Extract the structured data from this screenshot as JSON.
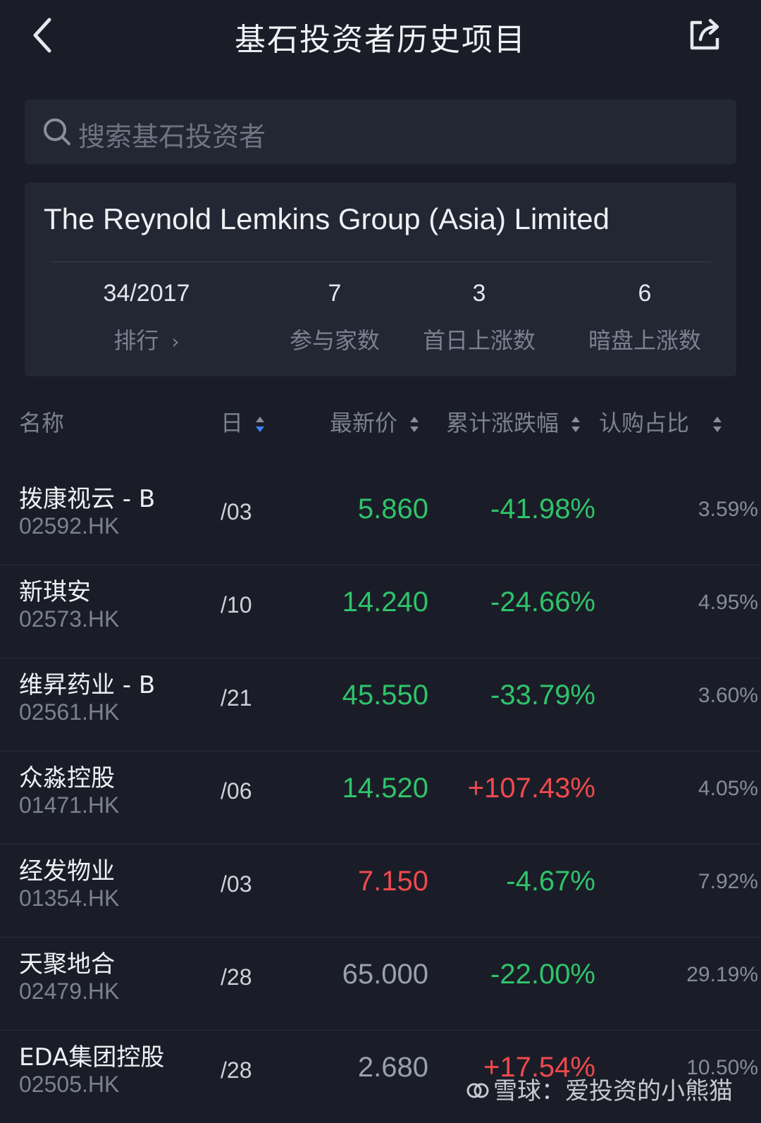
{
  "header": {
    "title": "基石投资者历史项目"
  },
  "search": {
    "placeholder": "搜索基石投资者"
  },
  "investor": {
    "name": "The Reynold Lemkins Group (Asia) Limited",
    "stats": [
      {
        "value": "34/2017",
        "label": "排行"
      },
      {
        "value": "7",
        "label": "参与家数"
      },
      {
        "value": "3",
        "label": "首日上涨数"
      },
      {
        "value": "6",
        "label": "暗盘上涨数"
      }
    ]
  },
  "table": {
    "headers": {
      "name": "名称",
      "date": "日",
      "price": "最新价",
      "change": "累计涨跌幅",
      "ratio": "认购占比"
    },
    "rows": [
      {
        "name": "拨康视云 - B",
        "code": "02592.HK",
        "date": "/03",
        "price": "5.860",
        "change": "-41.98%",
        "ratio": "3.59%",
        "price_color": "#2fc36b",
        "change_color": "#2fc36b"
      },
      {
        "name": "新琪安",
        "code": "02573.HK",
        "date": "/10",
        "price": "14.240",
        "change": "-24.66%",
        "ratio": "4.95%",
        "price_color": "#2fc36b",
        "change_color": "#2fc36b"
      },
      {
        "name": "维昇药业 - B",
        "code": "02561.HK",
        "date": "/21",
        "price": "45.550",
        "change": "-33.79%",
        "ratio": "3.60%",
        "price_color": "#2fc36b",
        "change_color": "#2fc36b"
      },
      {
        "name": "众淼控股",
        "code": "01471.HK",
        "date": "/06",
        "price": "14.520",
        "change": "+107.43%",
        "ratio": "4.05%",
        "price_color": "#2fc36b",
        "change_color": "#f0494d"
      },
      {
        "name": "经发物业",
        "code": "01354.HK",
        "date": "/03",
        "price": "7.150",
        "change": "-4.67%",
        "ratio": "7.92%",
        "price_color": "#f0494d",
        "change_color": "#2fc36b"
      },
      {
        "name": "天聚地合",
        "code": "02479.HK",
        "date": "/28",
        "price": "65.000",
        "change": "-22.00%",
        "ratio": "29.19%",
        "price_color": "#9aa0ac",
        "change_color": "#2fc36b"
      },
      {
        "name": "EDA集团控股",
        "code": "02505.HK",
        "date": "/28",
        "price": "2.680",
        "change": "+17.54%",
        "ratio": "10.50%",
        "price_color": "#9aa0ac",
        "change_color": "#f0494d"
      }
    ]
  },
  "watermark": {
    "text": "雪球：爱投资的小熊猫"
  },
  "colors": {
    "background": "#1a1d27",
    "card": "#232733",
    "up": "#f0494d",
    "down": "#2fc36b",
    "neutral": "#9aa0ac",
    "sort_active": "#3b82f6"
  }
}
